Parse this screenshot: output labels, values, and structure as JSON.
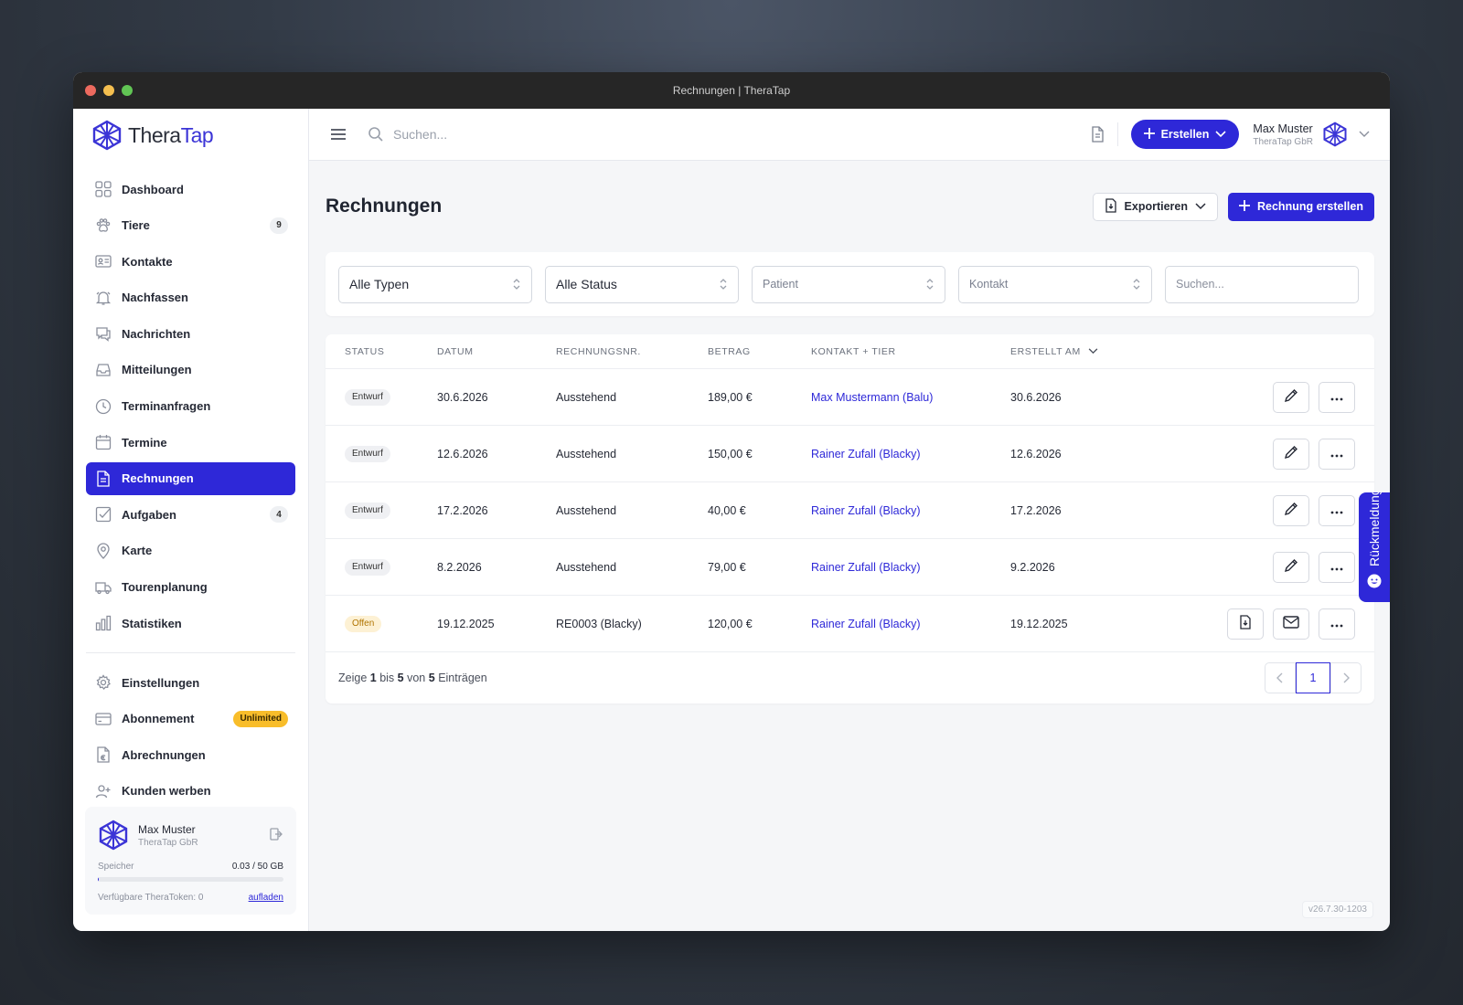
{
  "window": {
    "title": "Rechnungen | TheraTap"
  },
  "brand": {
    "name_a": "Thera",
    "name_b": "Tap"
  },
  "sidebar": {
    "items": [
      {
        "label": "Dashboard",
        "icon": "grid-icon"
      },
      {
        "label": "Tiere",
        "icon": "paw-icon",
        "count": "9"
      },
      {
        "label": "Kontakte",
        "icon": "contact-card-icon"
      },
      {
        "label": "Nachfassen",
        "icon": "bell-icon"
      },
      {
        "label": "Nachrichten",
        "icon": "chat-icon"
      },
      {
        "label": "Mitteilungen",
        "icon": "inbox-icon"
      },
      {
        "label": "Terminanfragen",
        "icon": "clock-icon"
      },
      {
        "label": "Termine",
        "icon": "calendar-icon"
      },
      {
        "label": "Rechnungen",
        "icon": "document-icon",
        "active": true
      },
      {
        "label": "Aufgaben",
        "icon": "checkbox-icon",
        "count": "4"
      },
      {
        "label": "Karte",
        "icon": "map-pin-icon"
      },
      {
        "label": "Tourenplanung",
        "icon": "truck-icon"
      },
      {
        "label": "Statistiken",
        "icon": "bar-chart-icon"
      }
    ],
    "bottom_items": [
      {
        "label": "Einstellungen",
        "icon": "gear-icon"
      },
      {
        "label": "Abonnement",
        "icon": "credit-card-icon",
        "pill": "Unlimited"
      },
      {
        "label": "Abrechnungen",
        "icon": "euro-document-icon"
      },
      {
        "label": "Kunden werben",
        "icon": "add-user-icon"
      }
    ],
    "user": {
      "name": "Max Muster",
      "org": "TheraTap GbR",
      "storage_label": "Speicher",
      "storage_value": "0.03 / 50 GB",
      "storage_fraction": 0.0006,
      "token_label": "Verfügbare TheraToken: 0",
      "token_link": "aufladen"
    }
  },
  "topbar": {
    "search_placeholder": "Suchen...",
    "create_label": "Erstellen",
    "user_name": "Max Muster",
    "user_org": "TheraTap GbR"
  },
  "page": {
    "title": "Rechnungen",
    "export_label": "Exportieren",
    "create_label": "Rechnung erstellen"
  },
  "filters": {
    "type": "Alle Typen",
    "status": "Alle Status",
    "patient": "Patient",
    "contact": "Kontakt",
    "search_placeholder": "Suchen..."
  },
  "table": {
    "headers": [
      "STATUS",
      "DATUM",
      "RECHNUNGSNR.",
      "BETRAG",
      "KONTAKT + TIER",
      "ERSTELLT AM"
    ],
    "rows": [
      {
        "status": "Entwurf",
        "status_type": "draft",
        "date": "30.6.2026",
        "nr": "Ausstehend",
        "amount": "189,00 €",
        "contact": "Max Mustermann",
        "pet": "(Balu)",
        "created": "30.6.2026"
      },
      {
        "status": "Entwurf",
        "status_type": "draft",
        "date": "12.6.2026",
        "nr": "Ausstehend",
        "amount": "150,00 €",
        "contact": "Rainer Zufall",
        "pet": "(Blacky)",
        "created": "12.6.2026"
      },
      {
        "status": "Entwurf",
        "status_type": "draft",
        "date": "17.2.2026",
        "nr": "Ausstehend",
        "amount": "40,00 €",
        "contact": "Rainer Zufall",
        "pet": "(Blacky)",
        "created": "17.2.2026"
      },
      {
        "status": "Entwurf",
        "status_type": "draft",
        "date": "8.2.2026",
        "nr": "Ausstehend",
        "amount": "79,00 €",
        "contact": "Rainer Zufall",
        "pet": "(Blacky)",
        "created": "9.2.2026"
      },
      {
        "status": "Offen",
        "status_type": "open",
        "date": "19.12.2025",
        "nr": "RE0003 (Blacky)",
        "amount": "120,00 €",
        "contact": "Rainer Zufall",
        "pet": "(Blacky)",
        "created": "19.12.2025"
      }
    ],
    "footer": {
      "p1": "Zeige",
      "from": "1",
      "p2": "bis",
      "to": "5",
      "p3": "von",
      "total": "5",
      "p4": "Einträgen"
    },
    "current_page": "1"
  },
  "feedback_label": "Rückmeldung",
  "version": "v26.7.30-1203",
  "colors": {
    "accent": "#2e28d8",
    "pill": "#f8bd2a",
    "open_badge": "#fdf1d4"
  }
}
